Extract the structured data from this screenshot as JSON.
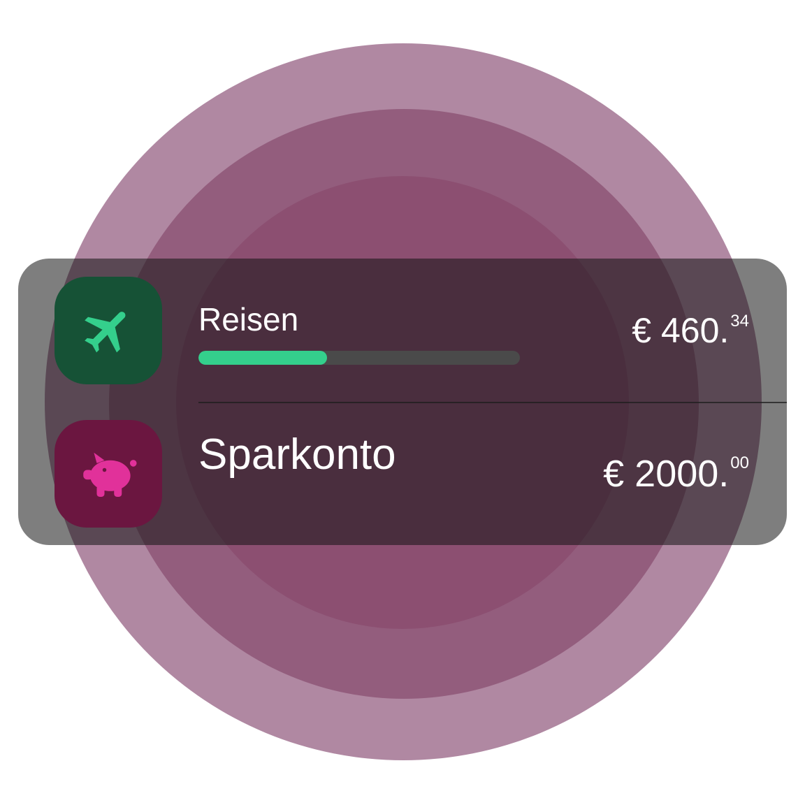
{
  "colors": {
    "ring_outer": "#b088a2",
    "ring_middle": "#935d7d",
    "ring_inner": "#8c4f71",
    "card_overlay": "rgba(20,20,20,0.55)",
    "travel_icon_bg": "#165236",
    "travel_icon_fg": "#34cf8c",
    "savings_icon_bg": "#6b1640",
    "savings_icon_fg": "#e1319a",
    "progress_fill": "#34cf8c",
    "progress_track": "#4a4a4a"
  },
  "accounts": [
    {
      "label": "Reisen",
      "icon": "airplane-icon",
      "amount_main": "€ 460.",
      "amount_cents": "34",
      "progress": 0.4
    },
    {
      "label": "Sparkonto",
      "icon": "piggy-bank-icon",
      "amount_main": "€ 2000.",
      "amount_cents": "00"
    }
  ]
}
